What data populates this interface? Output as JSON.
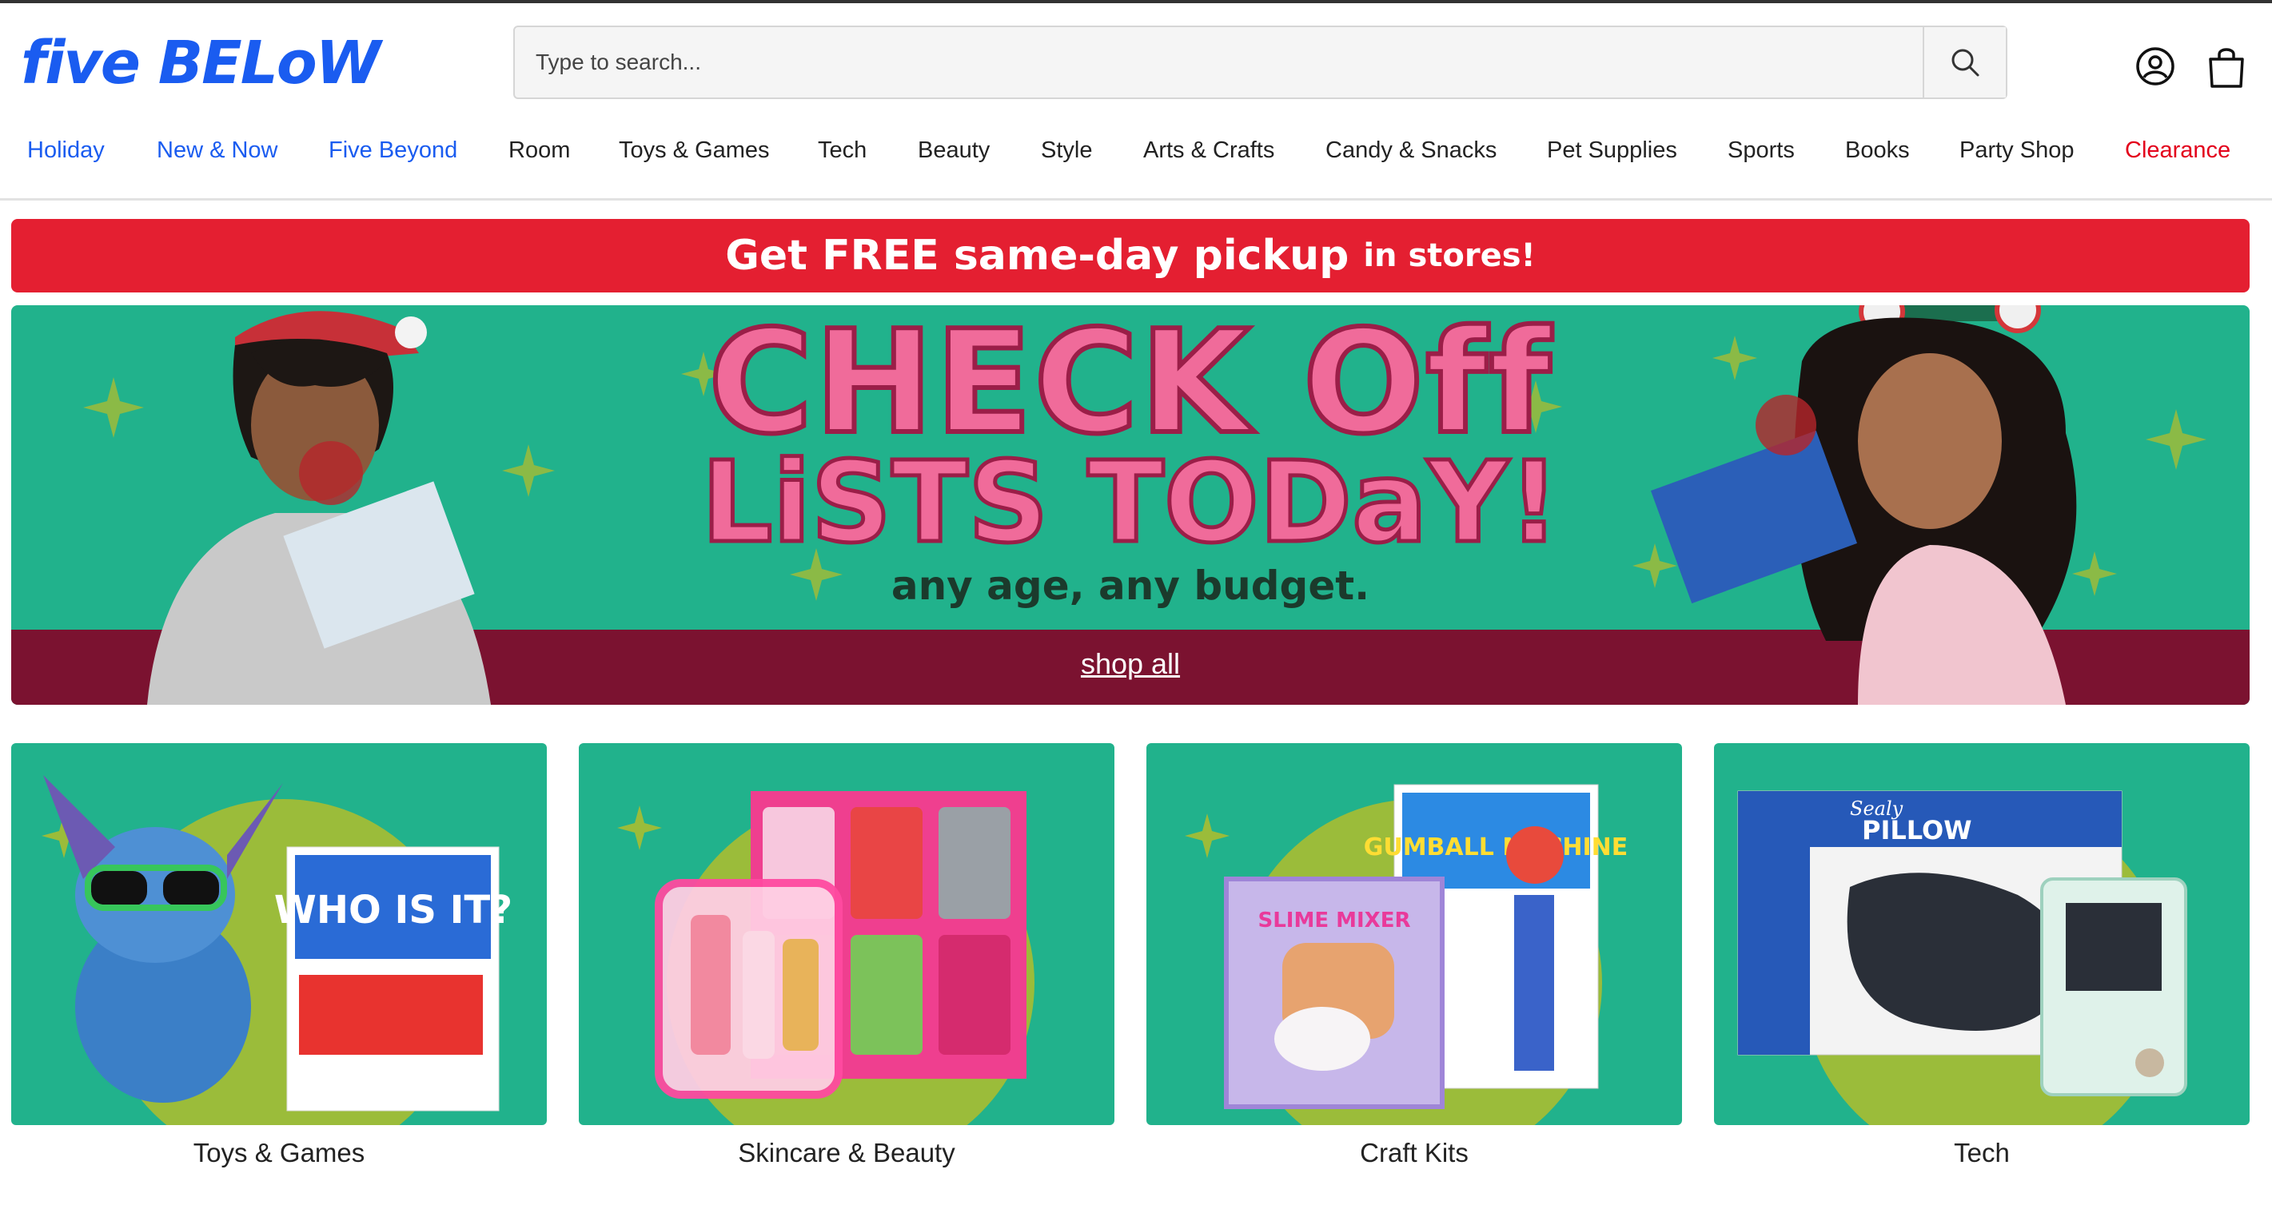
{
  "brand": {
    "logo_text": "five BELoW",
    "accent": "#1a5cf0",
    "promo_red": "#e41f31",
    "hero_green": "#21b28c",
    "hero_band": "#7b1230"
  },
  "search": {
    "placeholder": "Type to search...",
    "icon": "search-icon"
  },
  "header_icons": {
    "account": "account-icon",
    "cart": "shopping-bag-icon"
  },
  "nav": [
    {
      "label": "Holiday",
      "style": "blue"
    },
    {
      "label": "New & Now",
      "style": "blue"
    },
    {
      "label": "Five Beyond",
      "style": "blue"
    },
    {
      "label": "Room",
      "style": "default"
    },
    {
      "label": "Toys & Games",
      "style": "default"
    },
    {
      "label": "Tech",
      "style": "default"
    },
    {
      "label": "Beauty",
      "style": "default"
    },
    {
      "label": "Style",
      "style": "default"
    },
    {
      "label": "Arts & Crafts",
      "style": "default"
    },
    {
      "label": "Candy & Snacks",
      "style": "default"
    },
    {
      "label": "Pet Supplies",
      "style": "default"
    },
    {
      "label": "Sports",
      "style": "default"
    },
    {
      "label": "Books",
      "style": "default"
    },
    {
      "label": "Party Shop",
      "style": "default"
    },
    {
      "label": "Clearance",
      "style": "red"
    }
  ],
  "promo": {
    "main": "Get FREE same-day pickup",
    "suffix": "in stores!"
  },
  "hero": {
    "line1": "CHECK Off",
    "line2": "LiSTS TODaY!",
    "sub": "any age, any budget.",
    "cta": "shop all"
  },
  "categories": [
    {
      "label": "Toys & Games"
    },
    {
      "label": "Skincare & Beauty"
    },
    {
      "label": "Craft Kits"
    },
    {
      "label": "Tech"
    }
  ],
  "product_text": {
    "toys_box": "WHO IS IT?",
    "craft_box1": "SLIME MIXER",
    "craft_box2": "GUMBALL MACHINE",
    "tech_box_brand": "Sealy",
    "tech_box_name": "PILLOW"
  }
}
